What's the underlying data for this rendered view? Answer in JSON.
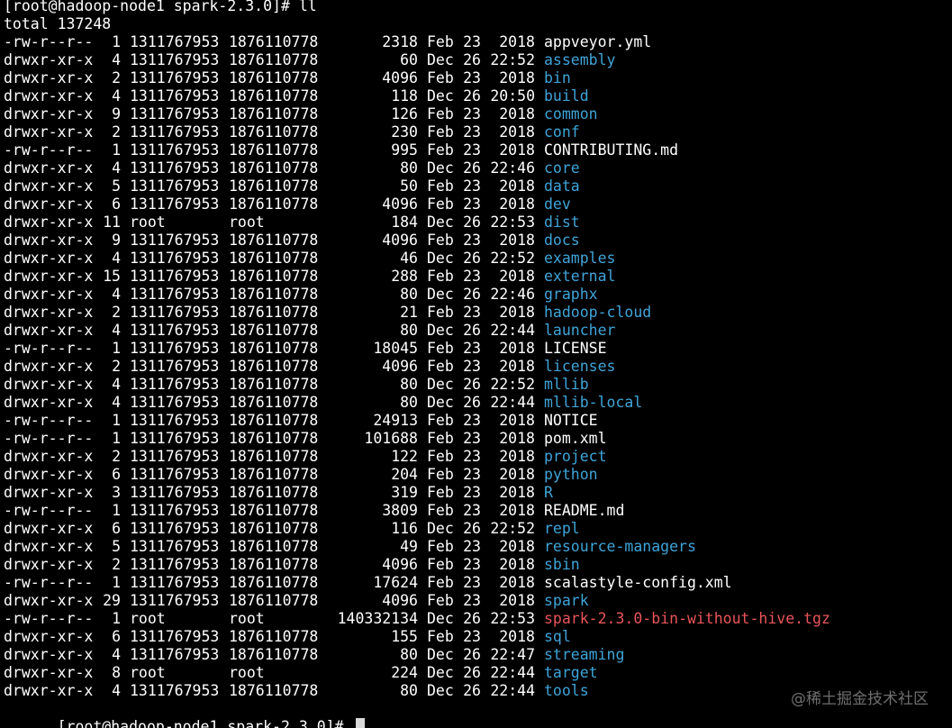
{
  "colors": {
    "background": "#000000",
    "text": "#ffffff",
    "directory": "#3fa4d8",
    "archive": "#e8555a",
    "cursor": "#d9d9d9"
  },
  "prompt_top": "[root@hadoop-node1 spark-2.3.0]# ll",
  "total_line": "total 137248",
  "entries": [
    {
      "perms": "-rw-r--r--",
      "links": "1",
      "owner": "1311767953",
      "group": "1876110778",
      "size": "2318",
      "month": "Feb",
      "day": "23",
      "time": "2018",
      "name": "appveyor.yml",
      "kind": "file"
    },
    {
      "perms": "drwxr-xr-x",
      "links": "4",
      "owner": "1311767953",
      "group": "1876110778",
      "size": "60",
      "month": "Dec",
      "day": "26",
      "time": "22:52",
      "name": "assembly",
      "kind": "dir"
    },
    {
      "perms": "drwxr-xr-x",
      "links": "2",
      "owner": "1311767953",
      "group": "1876110778",
      "size": "4096",
      "month": "Feb",
      "day": "23",
      "time": "2018",
      "name": "bin",
      "kind": "dir"
    },
    {
      "perms": "drwxr-xr-x",
      "links": "4",
      "owner": "1311767953",
      "group": "1876110778",
      "size": "118",
      "month": "Dec",
      "day": "26",
      "time": "20:50",
      "name": "build",
      "kind": "dir"
    },
    {
      "perms": "drwxr-xr-x",
      "links": "9",
      "owner": "1311767953",
      "group": "1876110778",
      "size": "126",
      "month": "Feb",
      "day": "23",
      "time": "2018",
      "name": "common",
      "kind": "dir"
    },
    {
      "perms": "drwxr-xr-x",
      "links": "2",
      "owner": "1311767953",
      "group": "1876110778",
      "size": "230",
      "month": "Feb",
      "day": "23",
      "time": "2018",
      "name": "conf",
      "kind": "dir"
    },
    {
      "perms": "-rw-r--r--",
      "links": "1",
      "owner": "1311767953",
      "group": "1876110778",
      "size": "995",
      "month": "Feb",
      "day": "23",
      "time": "2018",
      "name": "CONTRIBUTING.md",
      "kind": "file"
    },
    {
      "perms": "drwxr-xr-x",
      "links": "4",
      "owner": "1311767953",
      "group": "1876110778",
      "size": "80",
      "month": "Dec",
      "day": "26",
      "time": "22:46",
      "name": "core",
      "kind": "dir"
    },
    {
      "perms": "drwxr-xr-x",
      "links": "5",
      "owner": "1311767953",
      "group": "1876110778",
      "size": "50",
      "month": "Feb",
      "day": "23",
      "time": "2018",
      "name": "data",
      "kind": "dir"
    },
    {
      "perms": "drwxr-xr-x",
      "links": "6",
      "owner": "1311767953",
      "group": "1876110778",
      "size": "4096",
      "month": "Feb",
      "day": "23",
      "time": "2018",
      "name": "dev",
      "kind": "dir"
    },
    {
      "perms": "drwxr-xr-x",
      "links": "11",
      "owner": "root",
      "group": "root",
      "size": "184",
      "month": "Dec",
      "day": "26",
      "time": "22:53",
      "name": "dist",
      "kind": "dir"
    },
    {
      "perms": "drwxr-xr-x",
      "links": "9",
      "owner": "1311767953",
      "group": "1876110778",
      "size": "4096",
      "month": "Feb",
      "day": "23",
      "time": "2018",
      "name": "docs",
      "kind": "dir"
    },
    {
      "perms": "drwxr-xr-x",
      "links": "4",
      "owner": "1311767953",
      "group": "1876110778",
      "size": "46",
      "month": "Dec",
      "day": "26",
      "time": "22:52",
      "name": "examples",
      "kind": "dir"
    },
    {
      "perms": "drwxr-xr-x",
      "links": "15",
      "owner": "1311767953",
      "group": "1876110778",
      "size": "288",
      "month": "Feb",
      "day": "23",
      "time": "2018",
      "name": "external",
      "kind": "dir"
    },
    {
      "perms": "drwxr-xr-x",
      "links": "4",
      "owner": "1311767953",
      "group": "1876110778",
      "size": "80",
      "month": "Dec",
      "day": "26",
      "time": "22:46",
      "name": "graphx",
      "kind": "dir"
    },
    {
      "perms": "drwxr-xr-x",
      "links": "2",
      "owner": "1311767953",
      "group": "1876110778",
      "size": "21",
      "month": "Feb",
      "day": "23",
      "time": "2018",
      "name": "hadoop-cloud",
      "kind": "dir"
    },
    {
      "perms": "drwxr-xr-x",
      "links": "4",
      "owner": "1311767953",
      "group": "1876110778",
      "size": "80",
      "month": "Dec",
      "day": "26",
      "time": "22:44",
      "name": "launcher",
      "kind": "dir"
    },
    {
      "perms": "-rw-r--r--",
      "links": "1",
      "owner": "1311767953",
      "group": "1876110778",
      "size": "18045",
      "month": "Feb",
      "day": "23",
      "time": "2018",
      "name": "LICENSE",
      "kind": "file"
    },
    {
      "perms": "drwxr-xr-x",
      "links": "2",
      "owner": "1311767953",
      "group": "1876110778",
      "size": "4096",
      "month": "Feb",
      "day": "23",
      "time": "2018",
      "name": "licenses",
      "kind": "dir"
    },
    {
      "perms": "drwxr-xr-x",
      "links": "4",
      "owner": "1311767953",
      "group": "1876110778",
      "size": "80",
      "month": "Dec",
      "day": "26",
      "time": "22:52",
      "name": "mllib",
      "kind": "dir"
    },
    {
      "perms": "drwxr-xr-x",
      "links": "4",
      "owner": "1311767953",
      "group": "1876110778",
      "size": "80",
      "month": "Dec",
      "day": "26",
      "time": "22:44",
      "name": "mllib-local",
      "kind": "dir"
    },
    {
      "perms": "-rw-r--r--",
      "links": "1",
      "owner": "1311767953",
      "group": "1876110778",
      "size": "24913",
      "month": "Feb",
      "day": "23",
      "time": "2018",
      "name": "NOTICE",
      "kind": "file"
    },
    {
      "perms": "-rw-r--r--",
      "links": "1",
      "owner": "1311767953",
      "group": "1876110778",
      "size": "101688",
      "month": "Feb",
      "day": "23",
      "time": "2018",
      "name": "pom.xml",
      "kind": "file"
    },
    {
      "perms": "drwxr-xr-x",
      "links": "2",
      "owner": "1311767953",
      "group": "1876110778",
      "size": "122",
      "month": "Feb",
      "day": "23",
      "time": "2018",
      "name": "project",
      "kind": "dir"
    },
    {
      "perms": "drwxr-xr-x",
      "links": "6",
      "owner": "1311767953",
      "group": "1876110778",
      "size": "204",
      "month": "Feb",
      "day": "23",
      "time": "2018",
      "name": "python",
      "kind": "dir"
    },
    {
      "perms": "drwxr-xr-x",
      "links": "3",
      "owner": "1311767953",
      "group": "1876110778",
      "size": "319",
      "month": "Feb",
      "day": "23",
      "time": "2018",
      "name": "R",
      "kind": "dir"
    },
    {
      "perms": "-rw-r--r--",
      "links": "1",
      "owner": "1311767953",
      "group": "1876110778",
      "size": "3809",
      "month": "Feb",
      "day": "23",
      "time": "2018",
      "name": "README.md",
      "kind": "file"
    },
    {
      "perms": "drwxr-xr-x",
      "links": "6",
      "owner": "1311767953",
      "group": "1876110778",
      "size": "116",
      "month": "Dec",
      "day": "26",
      "time": "22:52",
      "name": "repl",
      "kind": "dir"
    },
    {
      "perms": "drwxr-xr-x",
      "links": "5",
      "owner": "1311767953",
      "group": "1876110778",
      "size": "49",
      "month": "Feb",
      "day": "23",
      "time": "2018",
      "name": "resource-managers",
      "kind": "dir"
    },
    {
      "perms": "drwxr-xr-x",
      "links": "2",
      "owner": "1311767953",
      "group": "1876110778",
      "size": "4096",
      "month": "Feb",
      "day": "23",
      "time": "2018",
      "name": "sbin",
      "kind": "dir"
    },
    {
      "perms": "-rw-r--r--",
      "links": "1",
      "owner": "1311767953",
      "group": "1876110778",
      "size": "17624",
      "month": "Feb",
      "day": "23",
      "time": "2018",
      "name": "scalastyle-config.xml",
      "kind": "file"
    },
    {
      "perms": "drwxr-xr-x",
      "links": "29",
      "owner": "1311767953",
      "group": "1876110778",
      "size": "4096",
      "month": "Feb",
      "day": "23",
      "time": "2018",
      "name": "spark",
      "kind": "dir"
    },
    {
      "perms": "-rw-r--r--",
      "links": "1",
      "owner": "root",
      "group": "root",
      "size": "140332134",
      "month": "Dec",
      "day": "26",
      "time": "22:53",
      "name": "spark-2.3.0-bin-without-hive.tgz",
      "kind": "archive"
    },
    {
      "perms": "drwxr-xr-x",
      "links": "6",
      "owner": "1311767953",
      "group": "1876110778",
      "size": "155",
      "month": "Feb",
      "day": "23",
      "time": "2018",
      "name": "sql",
      "kind": "dir"
    },
    {
      "perms": "drwxr-xr-x",
      "links": "4",
      "owner": "1311767953",
      "group": "1876110778",
      "size": "80",
      "month": "Dec",
      "day": "26",
      "time": "22:47",
      "name": "streaming",
      "kind": "dir"
    },
    {
      "perms": "drwxr-xr-x",
      "links": "8",
      "owner": "root",
      "group": "root",
      "size": "224",
      "month": "Dec",
      "day": "26",
      "time": "22:44",
      "name": "target",
      "kind": "dir"
    },
    {
      "perms": "drwxr-xr-x",
      "links": "4",
      "owner": "1311767953",
      "group": "1876110778",
      "size": "80",
      "month": "Dec",
      "day": "26",
      "time": "22:44",
      "name": "tools",
      "kind": "dir"
    }
  ],
  "prompt_bottom": "[root@hadoop-node1 spark-2.3.0]# ",
  "watermark": "@稀土掘金技术社区"
}
